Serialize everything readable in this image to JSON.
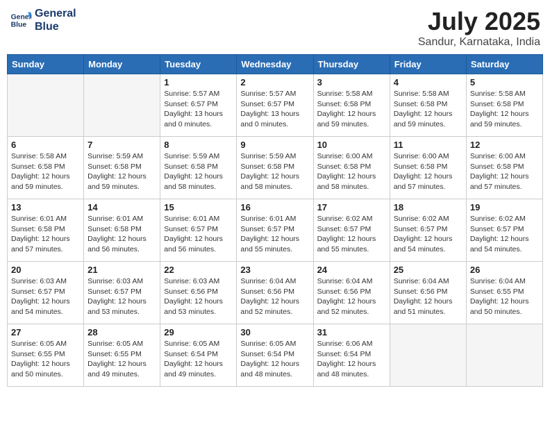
{
  "logo": {
    "line1": "General",
    "line2": "Blue"
  },
  "title": "July 2025",
  "location": "Sandur, Karnataka, India",
  "weekdays": [
    "Sunday",
    "Monday",
    "Tuesday",
    "Wednesday",
    "Thursday",
    "Friday",
    "Saturday"
  ],
  "weeks": [
    [
      {
        "day": "",
        "info": ""
      },
      {
        "day": "",
        "info": ""
      },
      {
        "day": "1",
        "info": "Sunrise: 5:57 AM\nSunset: 6:57 PM\nDaylight: 13 hours\nand 0 minutes."
      },
      {
        "day": "2",
        "info": "Sunrise: 5:57 AM\nSunset: 6:57 PM\nDaylight: 13 hours\nand 0 minutes."
      },
      {
        "day": "3",
        "info": "Sunrise: 5:58 AM\nSunset: 6:58 PM\nDaylight: 12 hours\nand 59 minutes."
      },
      {
        "day": "4",
        "info": "Sunrise: 5:58 AM\nSunset: 6:58 PM\nDaylight: 12 hours\nand 59 minutes."
      },
      {
        "day": "5",
        "info": "Sunrise: 5:58 AM\nSunset: 6:58 PM\nDaylight: 12 hours\nand 59 minutes."
      }
    ],
    [
      {
        "day": "6",
        "info": "Sunrise: 5:58 AM\nSunset: 6:58 PM\nDaylight: 12 hours\nand 59 minutes."
      },
      {
        "day": "7",
        "info": "Sunrise: 5:59 AM\nSunset: 6:58 PM\nDaylight: 12 hours\nand 59 minutes."
      },
      {
        "day": "8",
        "info": "Sunrise: 5:59 AM\nSunset: 6:58 PM\nDaylight: 12 hours\nand 58 minutes."
      },
      {
        "day": "9",
        "info": "Sunrise: 5:59 AM\nSunset: 6:58 PM\nDaylight: 12 hours\nand 58 minutes."
      },
      {
        "day": "10",
        "info": "Sunrise: 6:00 AM\nSunset: 6:58 PM\nDaylight: 12 hours\nand 58 minutes."
      },
      {
        "day": "11",
        "info": "Sunrise: 6:00 AM\nSunset: 6:58 PM\nDaylight: 12 hours\nand 57 minutes."
      },
      {
        "day": "12",
        "info": "Sunrise: 6:00 AM\nSunset: 6:58 PM\nDaylight: 12 hours\nand 57 minutes."
      }
    ],
    [
      {
        "day": "13",
        "info": "Sunrise: 6:01 AM\nSunset: 6:58 PM\nDaylight: 12 hours\nand 57 minutes."
      },
      {
        "day": "14",
        "info": "Sunrise: 6:01 AM\nSunset: 6:58 PM\nDaylight: 12 hours\nand 56 minutes."
      },
      {
        "day": "15",
        "info": "Sunrise: 6:01 AM\nSunset: 6:57 PM\nDaylight: 12 hours\nand 56 minutes."
      },
      {
        "day": "16",
        "info": "Sunrise: 6:01 AM\nSunset: 6:57 PM\nDaylight: 12 hours\nand 55 minutes."
      },
      {
        "day": "17",
        "info": "Sunrise: 6:02 AM\nSunset: 6:57 PM\nDaylight: 12 hours\nand 55 minutes."
      },
      {
        "day": "18",
        "info": "Sunrise: 6:02 AM\nSunset: 6:57 PM\nDaylight: 12 hours\nand 54 minutes."
      },
      {
        "day": "19",
        "info": "Sunrise: 6:02 AM\nSunset: 6:57 PM\nDaylight: 12 hours\nand 54 minutes."
      }
    ],
    [
      {
        "day": "20",
        "info": "Sunrise: 6:03 AM\nSunset: 6:57 PM\nDaylight: 12 hours\nand 54 minutes."
      },
      {
        "day": "21",
        "info": "Sunrise: 6:03 AM\nSunset: 6:57 PM\nDaylight: 12 hours\nand 53 minutes."
      },
      {
        "day": "22",
        "info": "Sunrise: 6:03 AM\nSunset: 6:56 PM\nDaylight: 12 hours\nand 53 minutes."
      },
      {
        "day": "23",
        "info": "Sunrise: 6:04 AM\nSunset: 6:56 PM\nDaylight: 12 hours\nand 52 minutes."
      },
      {
        "day": "24",
        "info": "Sunrise: 6:04 AM\nSunset: 6:56 PM\nDaylight: 12 hours\nand 52 minutes."
      },
      {
        "day": "25",
        "info": "Sunrise: 6:04 AM\nSunset: 6:56 PM\nDaylight: 12 hours\nand 51 minutes."
      },
      {
        "day": "26",
        "info": "Sunrise: 6:04 AM\nSunset: 6:55 PM\nDaylight: 12 hours\nand 50 minutes."
      }
    ],
    [
      {
        "day": "27",
        "info": "Sunrise: 6:05 AM\nSunset: 6:55 PM\nDaylight: 12 hours\nand 50 minutes."
      },
      {
        "day": "28",
        "info": "Sunrise: 6:05 AM\nSunset: 6:55 PM\nDaylight: 12 hours\nand 49 minutes."
      },
      {
        "day": "29",
        "info": "Sunrise: 6:05 AM\nSunset: 6:54 PM\nDaylight: 12 hours\nand 49 minutes."
      },
      {
        "day": "30",
        "info": "Sunrise: 6:05 AM\nSunset: 6:54 PM\nDaylight: 12 hours\nand 48 minutes."
      },
      {
        "day": "31",
        "info": "Sunrise: 6:06 AM\nSunset: 6:54 PM\nDaylight: 12 hours\nand 48 minutes."
      },
      {
        "day": "",
        "info": ""
      },
      {
        "day": "",
        "info": ""
      }
    ]
  ]
}
